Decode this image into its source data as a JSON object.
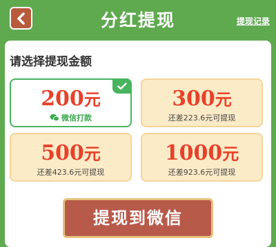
{
  "header": {
    "title": "分红提现",
    "record_link": "提现记录"
  },
  "section_title": "请选择提现金额",
  "options": [
    {
      "amount": "200",
      "unit": "元",
      "sub": "微信打款",
      "selected": true
    },
    {
      "amount": "300",
      "unit": "元",
      "sub": "还差223.6元可提现",
      "selected": false
    },
    {
      "amount": "500",
      "unit": "元",
      "sub": "还差423.6元可提现",
      "selected": false
    },
    {
      "amount": "1000",
      "unit": "元",
      "sub": "还差923.6元可提现",
      "selected": false
    }
  ],
  "withdraw_button": "提现到微信",
  "colors": {
    "background": "#5fa94f",
    "accent_red": "#e8412a",
    "selected_green": "#48b45e",
    "button": "#b85a4a"
  },
  "icons": {
    "back": "chevron-left-icon",
    "check": "check-icon",
    "wechat": "wechat-icon"
  }
}
